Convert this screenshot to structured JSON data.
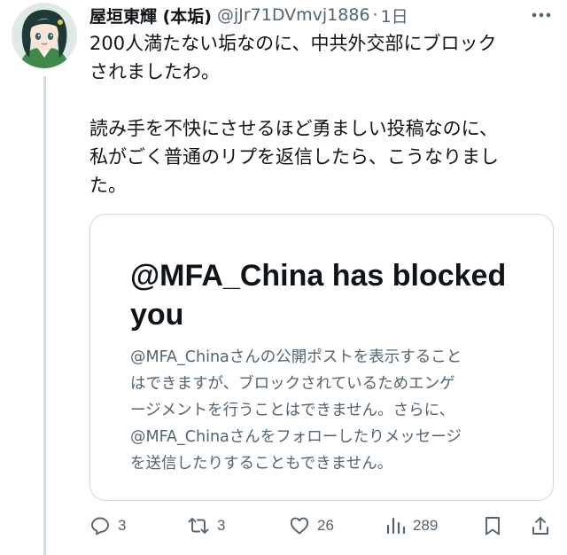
{
  "tweet": {
    "display_name": "屋垣東輝 (本垢)",
    "handle": "@jJr71DVmvj1886",
    "separator": "·",
    "time": "1日",
    "text_lines": [
      "200人満たない垢なのに、中共外交部にブロック",
      "されましたわ。",
      "",
      "読み手を不快にさせるほど勇ましい投稿なのに、",
      "私がごく普通のリプを返信したら、こうなりまし",
      "た。"
    ]
  },
  "card": {
    "title": "@MFA_China has blocked you",
    "body_lines": [
      "@MFA_Chinaさんの公開ポストを表示すること",
      "はできますが、ブロックされているためエンゲ",
      "ージメントを行うことはできません。さらに、",
      "@MFA_Chinaさんをフォローしたりメッセージ",
      "を送信したりすることもできません。"
    ]
  },
  "actions": {
    "reply_count": "3",
    "retweet_count": "3",
    "like_count": "26",
    "views_count": "289"
  },
  "icons": {
    "reply": "reply-icon",
    "retweet": "retweet-icon",
    "like": "heart-icon",
    "views": "views-icon",
    "bookmark": "bookmark-icon",
    "share": "share-icon",
    "more": "more-icon"
  },
  "colors": {
    "text": "#0f1419",
    "secondary": "#536471",
    "border": "#cfd9de"
  }
}
